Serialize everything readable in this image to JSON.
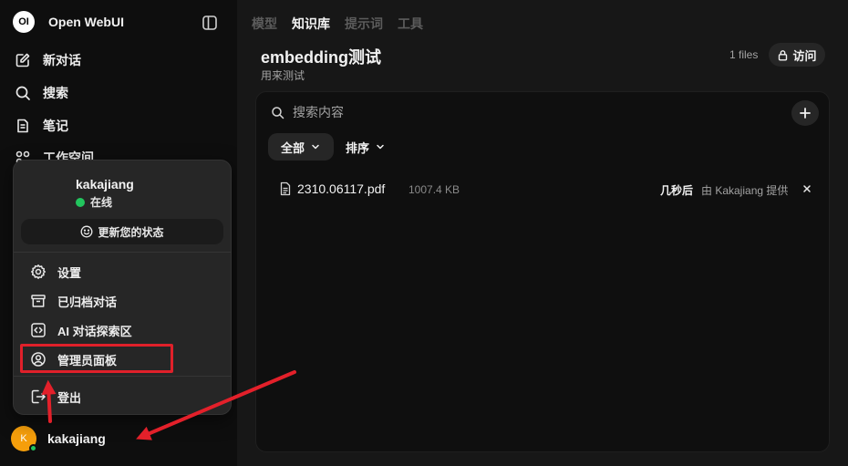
{
  "app": {
    "name": "Open WebUI",
    "logo_text": "OI"
  },
  "sidebar": {
    "items": [
      {
        "label": "新对话",
        "icon": "edit-icon"
      },
      {
        "label": "搜索",
        "icon": "search-icon"
      },
      {
        "label": "笔记",
        "icon": "notes-icon"
      },
      {
        "label": "工作空间",
        "icon": "workspace-icon"
      }
    ],
    "user": {
      "name": "kakajiang",
      "avatar_letter": "K",
      "avatar_color": "#f59e0b"
    }
  },
  "user_menu": {
    "username": "kakajiang",
    "status": "在线",
    "update_status_label": "更新您的状态",
    "items": [
      {
        "label": "设置",
        "icon": "gear-icon"
      },
      {
        "label": "已归档对话",
        "icon": "archive-icon"
      },
      {
        "label": "AI 对话探索区",
        "icon": "code-icon"
      },
      {
        "label": "管理员面板",
        "icon": "user-circle-icon"
      },
      {
        "label": "登出",
        "icon": "logout-icon"
      }
    ]
  },
  "workspace_tabs": [
    {
      "label": "模型",
      "active": false
    },
    {
      "label": "知识库",
      "active": true
    },
    {
      "label": "提示词",
      "active": false
    },
    {
      "label": "工具",
      "active": false
    }
  ],
  "knowledge": {
    "title": "embedding测试",
    "description": "用来测试",
    "files_count": "1 files",
    "access_label": "访问",
    "search_placeholder": "搜索内容",
    "filter_label": "全部",
    "sort_label": "排序",
    "files": [
      {
        "name": "2310.06117.pdf",
        "size": "1007.4 KB",
        "time": "几秒后",
        "uploaded_by": "由 Kakajiang 提供"
      }
    ]
  },
  "colors": {
    "highlight": "#e0202a",
    "online": "#22c55e"
  }
}
